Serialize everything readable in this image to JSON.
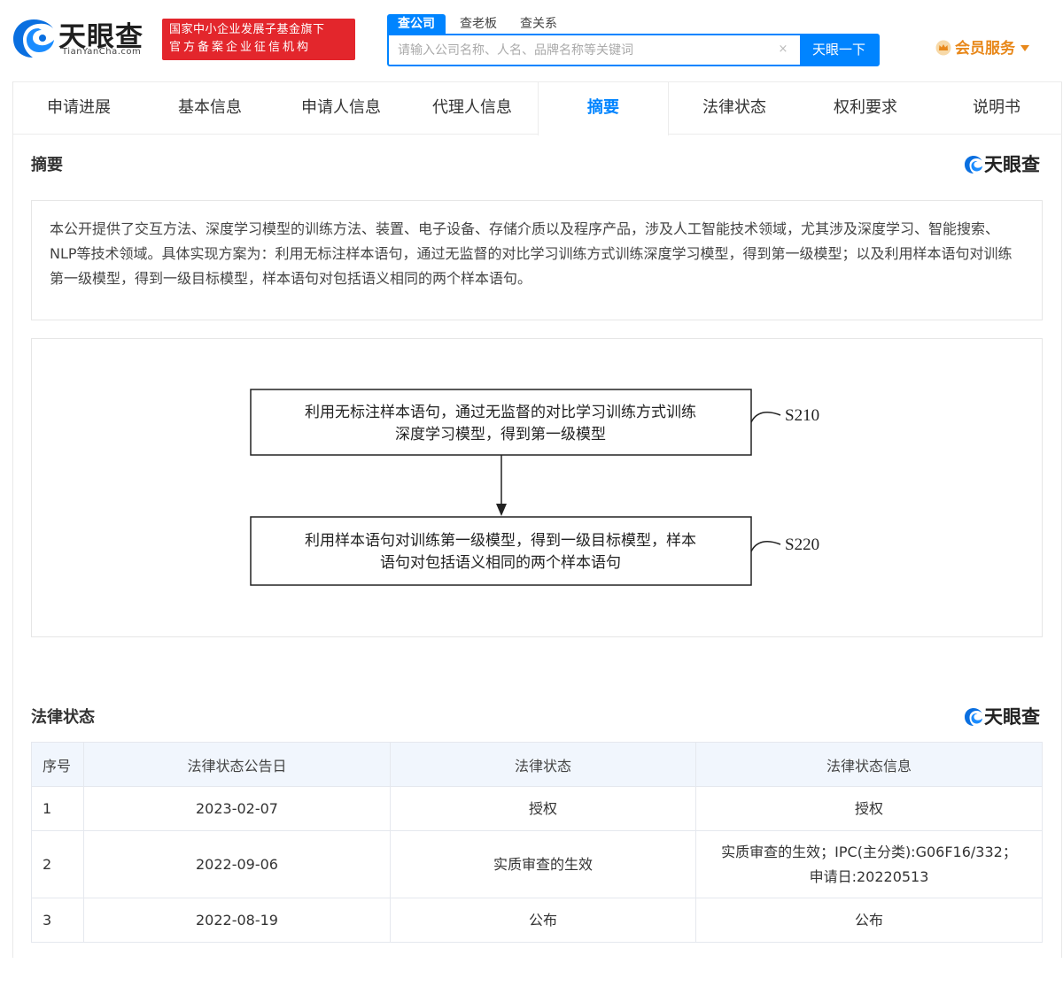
{
  "header": {
    "logo_text": "天眼查",
    "logo_sub": "TianYanCha.com",
    "badge_line1": "国家中小企业发展子基金旗下",
    "badge_line2": "官方备案企业征信机构",
    "search_tabs": [
      {
        "label": "查公司"
      },
      {
        "label": "查老板"
      },
      {
        "label": "查关系"
      }
    ],
    "search_placeholder": "请输入公司名称、人名、品牌名称等关键词",
    "search_clear": "×",
    "search_button": "天眼一下",
    "member_label": "会员服务"
  },
  "nav": {
    "items": [
      {
        "label": "申请进展"
      },
      {
        "label": "基本信息"
      },
      {
        "label": "申请人信息"
      },
      {
        "label": "代理人信息"
      },
      {
        "label": "摘要"
      },
      {
        "label": "法律状态"
      },
      {
        "label": "权利要求"
      },
      {
        "label": "说明书"
      }
    ],
    "active": "摘要"
  },
  "abstract": {
    "title": "摘要",
    "brand": "天眼查",
    "text": "本公开提供了交互方法、深度学习模型的训练方法、装置、电子设备、存储介质以及程序产品，涉及人工智能技术领域，尤其涉及深度学习、智能搜索、NLP等技术领域。具体实现方案为：利用无标注样本语句，通过无监督的对比学习训练方式训练深度学习模型，得到第一级模型；以及利用样本语句对训练第一级模型，得到一级目标模型，样本语句对包括语义相同的两个样本语句。"
  },
  "flowchart": {
    "step1": {
      "line1": "利用无标注样本语句，通过无监督的对比学习训练方式训练",
      "line2": "深度学习模型，得到第一级模型",
      "label": "S210"
    },
    "step2": {
      "line1": "利用样本语句对训练第一级模型，得到一级目标模型，样本",
      "line2": "语句对包括语义相同的两个样本语句",
      "label": "S220"
    }
  },
  "legal": {
    "title": "法律状态",
    "brand": "天眼查",
    "headers": {
      "idx": "序号",
      "date": "法律状态公告日",
      "status": "法律状态",
      "info": "法律状态信息"
    },
    "rows": [
      {
        "idx": "1",
        "date": "2023-02-07",
        "status": "授权",
        "info_line1": "授权",
        "info_line2": ""
      },
      {
        "idx": "2",
        "date": "2022-09-06",
        "status": "实质审查的生效",
        "info_line1": "实质审查的生效；IPC(主分类):G06F16/332；",
        "info_line2": "申请日:20220513"
      },
      {
        "idx": "3",
        "date": "2022-08-19",
        "status": "公布",
        "info_line1": "公布",
        "info_line2": ""
      }
    ]
  },
  "colors": {
    "accent": "#0084ff",
    "badge": "#e3262c",
    "member": "#e8881b",
    "table_header": "#f1f6fd"
  }
}
